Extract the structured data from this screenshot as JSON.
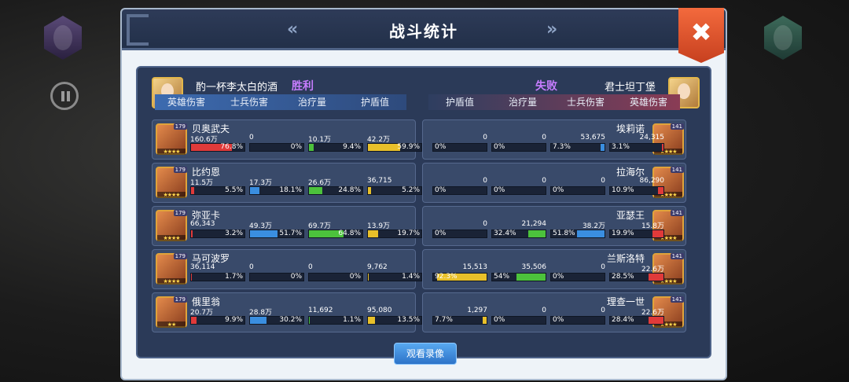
{
  "title": "战斗统计",
  "close_label": "✖",
  "prev_arrow": "«",
  "next_arrow": "»",
  "left_player": {
    "name": "酌一杯李太白的酒",
    "result": "胜利"
  },
  "right_player": {
    "name": "君士坦丁堡",
    "result": "失败"
  },
  "left_columns": [
    "英雄伤害",
    "士兵伤害",
    "治疗量",
    "护盾值"
  ],
  "right_columns": [
    "护盾值",
    "治疗量",
    "士兵伤害",
    "英雄伤害"
  ],
  "bar_colors": {
    "hero": "#e03a3a",
    "soldier": "#3a8ee0",
    "heal": "#4cc23c",
    "shield": "#e8c02a"
  },
  "left_heroes": [
    {
      "name": "贝奥武夫",
      "level": "179",
      "stars": "★★★★",
      "stats": [
        {
          "value": "160.6万",
          "pct": "76.8%"
        },
        {
          "value": "0",
          "pct": "0%"
        },
        {
          "value": "10.1万",
          "pct": "9.4%"
        },
        {
          "value": "42.2万",
          "pct": "59.9%"
        }
      ]
    },
    {
      "name": "比约恩",
      "level": "179",
      "stars": "★★★★",
      "stats": [
        {
          "value": "11.5万",
          "pct": "5.5%"
        },
        {
          "value": "17.3万",
          "pct": "18.1%"
        },
        {
          "value": "26.6万",
          "pct": "24.8%"
        },
        {
          "value": "36,715",
          "pct": "5.2%"
        }
      ]
    },
    {
      "name": "弥亚卡",
      "level": "179",
      "stars": "★★★★",
      "stats": [
        {
          "value": "66,343",
          "pct": "3.2%"
        },
        {
          "value": "49.3万",
          "pct": "51.7%"
        },
        {
          "value": "69.7万",
          "pct": "64.8%"
        },
        {
          "value": "13.9万",
          "pct": "19.7%"
        }
      ]
    },
    {
      "name": "马可波罗",
      "level": "179",
      "stars": "★★★★",
      "stats": [
        {
          "value": "36,114",
          "pct": "1.7%"
        },
        {
          "value": "0",
          "pct": "0%"
        },
        {
          "value": "0",
          "pct": "0%"
        },
        {
          "value": "9,762",
          "pct": "1.4%"
        }
      ]
    },
    {
      "name": "俄里翁",
      "level": "179",
      "stars": "★★",
      "stats": [
        {
          "value": "20.7万",
          "pct": "9.9%"
        },
        {
          "value": "28.8万",
          "pct": "30.2%"
        },
        {
          "value": "11,692",
          "pct": "1.1%"
        },
        {
          "value": "95,080",
          "pct": "13.5%"
        }
      ]
    }
  ],
  "right_heroes": [
    {
      "name": "埃莉诺",
      "level": "141",
      "stars": "★★★★",
      "stats": [
        {
          "value": "0",
          "pct": "0%"
        },
        {
          "value": "0",
          "pct": "0%"
        },
        {
          "value": "53,675",
          "pct": "7.3%"
        },
        {
          "value": "24,315",
          "pct": "3.1%"
        }
      ]
    },
    {
      "name": "拉海尔",
      "level": "141",
      "stars": "★★★★",
      "stats": [
        {
          "value": "0",
          "pct": "0%"
        },
        {
          "value": "0",
          "pct": "0%"
        },
        {
          "value": "0",
          "pct": "0%"
        },
        {
          "value": "86,290",
          "pct": "10.9%"
        }
      ]
    },
    {
      "name": "亚瑟王",
      "level": "141",
      "stars": "★★★★",
      "stats": [
        {
          "value": "0",
          "pct": "0%"
        },
        {
          "value": "21,294",
          "pct": "32.4%"
        },
        {
          "value": "38.2万",
          "pct": "51.8%"
        },
        {
          "value": "15.8万",
          "pct": "19.9%"
        }
      ]
    },
    {
      "name": "兰斯洛特",
      "level": "141",
      "stars": "★★★★",
      "stats": [
        {
          "value": "15,513",
          "pct": "92.3%"
        },
        {
          "value": "35,506",
          "pct": "54%"
        },
        {
          "value": "0",
          "pct": "0%"
        },
        {
          "value": "22.6万",
          "pct": "28.5%"
        }
      ]
    },
    {
      "name": "理查一世",
      "level": "141",
      "stars": "★★★★",
      "stats": [
        {
          "value": "1,297",
          "pct": "7.7%"
        },
        {
          "value": "0",
          "pct": "0%"
        },
        {
          "value": "0",
          "pct": "0%"
        },
        {
          "value": "22.6万",
          "pct": "28.4%"
        }
      ]
    }
  ],
  "view_replay_label": "观看录像"
}
